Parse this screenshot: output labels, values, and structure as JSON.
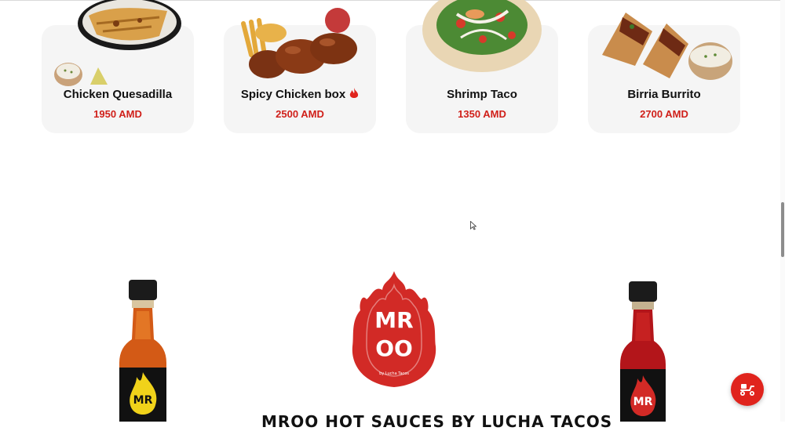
{
  "products": [
    {
      "name": "Chicken Quesadilla",
      "price": "1950 AMD",
      "spicy": false,
      "image": "chicken-quesadilla-image"
    },
    {
      "name": "Spicy Chicken box",
      "price": "2500 AMD",
      "spicy": true,
      "image": "spicy-chicken-box-image"
    },
    {
      "name": "Shrimp Taco",
      "price": "1350 AMD",
      "spicy": false,
      "image": "shrimp-taco-image"
    },
    {
      "name": "Birria Burrito",
      "price": "2700 AMD",
      "spicy": false,
      "image": "birria-burrito-image"
    }
  ],
  "sauces": {
    "title": "MROO HOT SAUCES BY LUCHA TACOS",
    "logo": {
      "text_top": "MR",
      "text_bottom": "OO",
      "tagline": "by Lucha Tacos"
    },
    "bottle_labels": {
      "left": "MR",
      "right": "MR"
    }
  },
  "delivery_button": {
    "icon": "scooter-icon"
  },
  "colors": {
    "accent": "#d0201a",
    "button": "#e0241d",
    "card_bg": "#f5f5f5"
  }
}
